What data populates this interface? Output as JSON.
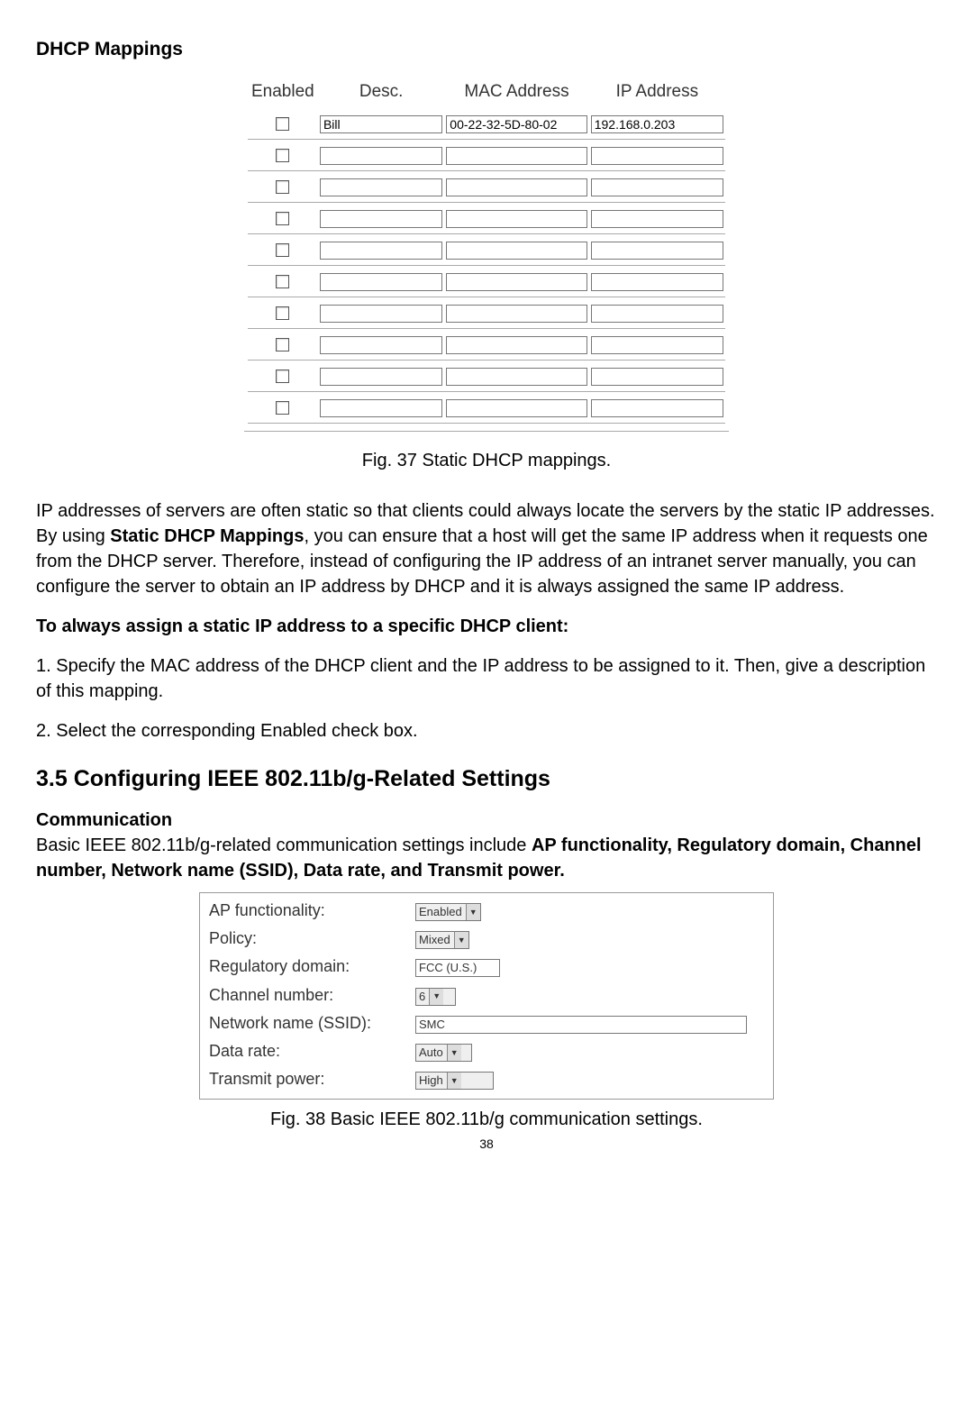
{
  "heading_dhcp": "DHCP Mappings",
  "dhcp_table": {
    "headers": {
      "enabled": "Enabled",
      "desc": "Desc.",
      "mac": "MAC Address",
      "ip": "IP Address"
    },
    "rows": [
      {
        "enabled": false,
        "desc": "Bill",
        "mac": "00-22-32-5D-80-02",
        "ip": "192.168.0.203"
      },
      {
        "enabled": false,
        "desc": "",
        "mac": "",
        "ip": ""
      },
      {
        "enabled": false,
        "desc": "",
        "mac": "",
        "ip": ""
      },
      {
        "enabled": false,
        "desc": "",
        "mac": "",
        "ip": ""
      },
      {
        "enabled": false,
        "desc": "",
        "mac": "",
        "ip": ""
      },
      {
        "enabled": false,
        "desc": "",
        "mac": "",
        "ip": ""
      },
      {
        "enabled": false,
        "desc": "",
        "mac": "",
        "ip": ""
      },
      {
        "enabled": false,
        "desc": "",
        "mac": "",
        "ip": ""
      },
      {
        "enabled": false,
        "desc": "",
        "mac": "",
        "ip": ""
      },
      {
        "enabled": false,
        "desc": "",
        "mac": "",
        "ip": ""
      }
    ]
  },
  "fig37_caption": "Fig. 37 Static DHCP mappings.",
  "para1_a": "IP addresses of servers are often static so that clients could always locate the servers by the static IP addresses. By using ",
  "para1_b": "Static DHCP Mappings",
  "para1_c": ", you can ensure that a host will get the same IP address when it requests one from the DHCP server. Therefore, instead of configuring the IP address of an intranet server manually, you can configure the server to obtain an IP address by DHCP and it is always assigned the same IP address.",
  "para2": "To always assign a static IP address to a specific DHCP client:",
  "step1": "1. Specify the MAC address of the DHCP client and the IP address to be assigned to it. Then, give a description of this mapping.",
  "step2": "2. Select the corresponding Enabled check box.",
  "heading_35": "3.5 Configuring IEEE 802.11b/g-Related Settings",
  "subheading_comm": "Communication",
  "para3_a": "Basic IEEE 802.11b/g-related communication settings include ",
  "para3_b": "AP functionality, Regulatory domain, Channel number, Network name (SSID), Data rate, and Transmit power.",
  "comm": {
    "labels": {
      "ap": "AP functionality:",
      "policy": "Policy:",
      "reg": "Regulatory domain:",
      "channel": "Channel number:",
      "ssid": "Network name (SSID):",
      "rate": "Data rate:",
      "power": "Transmit power:"
    },
    "values": {
      "ap": "Enabled",
      "policy": "Mixed",
      "reg": "FCC (U.S.)",
      "channel": "6",
      "ssid": "SMC",
      "rate": "Auto",
      "power": "High"
    }
  },
  "fig38_caption": "Fig. 38 Basic IEEE 802.11b/g communication settings.",
  "page_number": "38"
}
